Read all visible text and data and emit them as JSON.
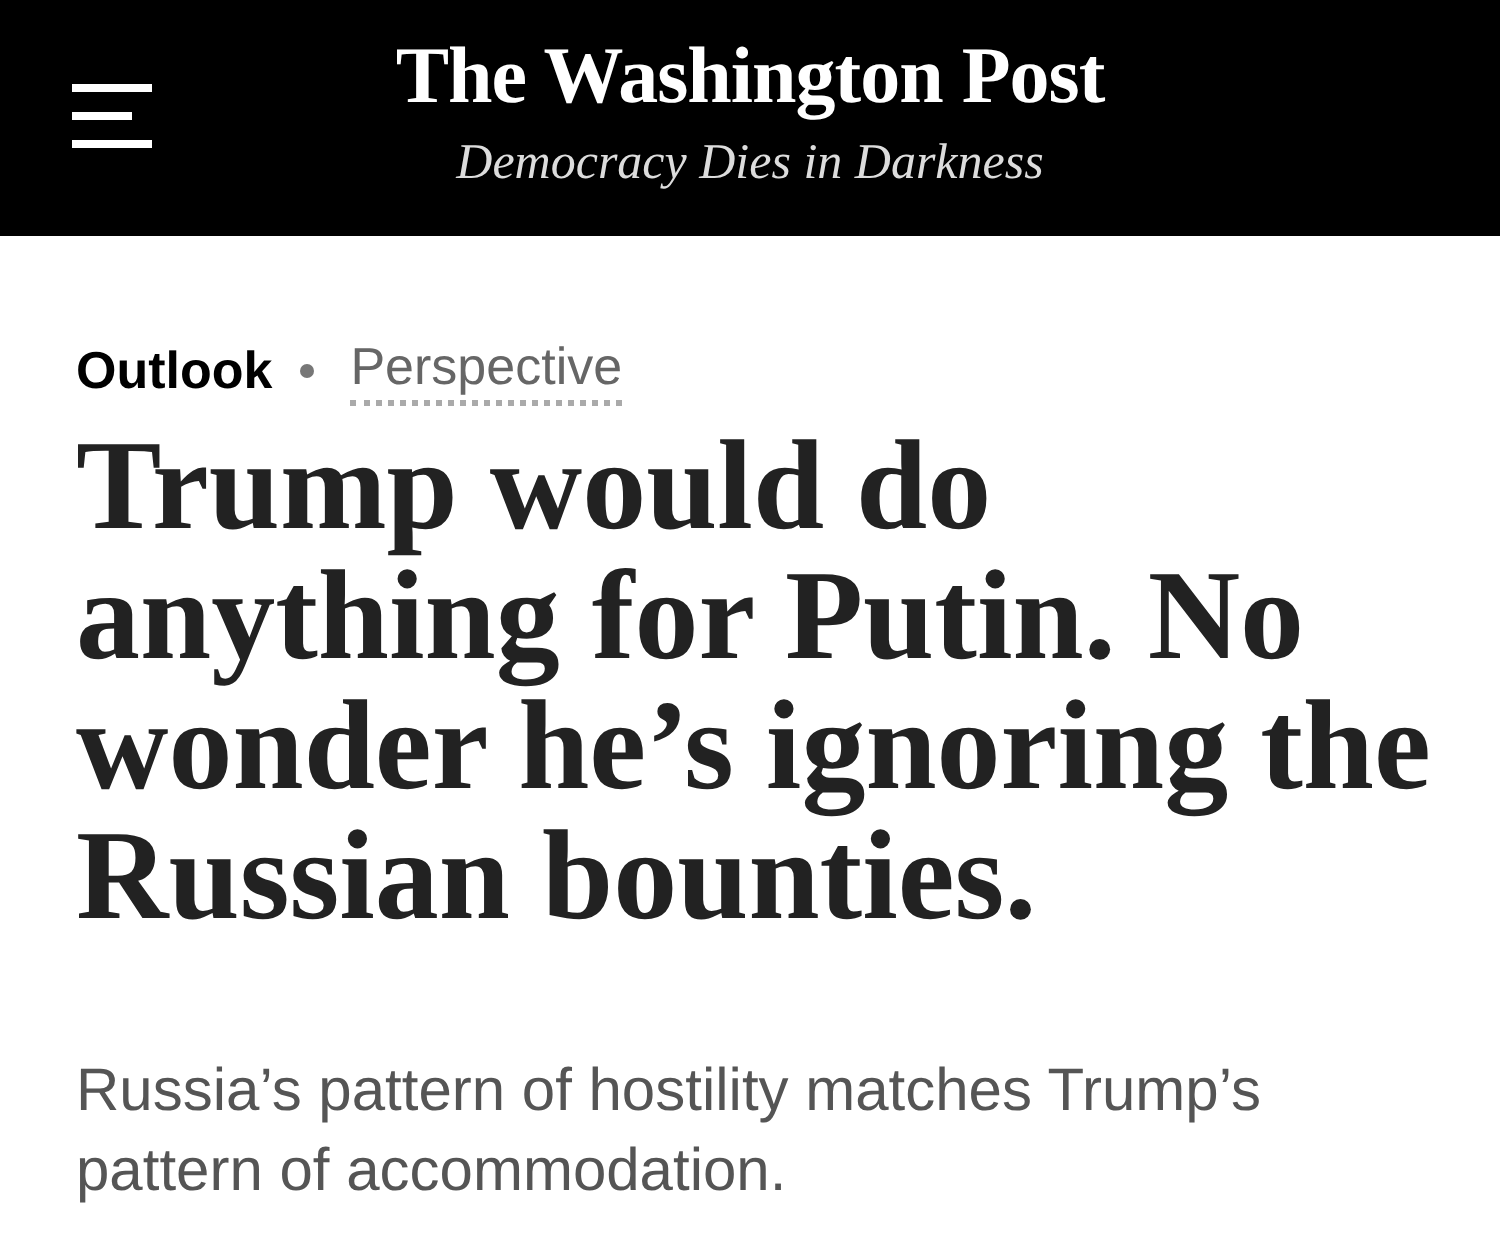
{
  "header": {
    "logo": "The Washington Post",
    "tagline": "Democracy Dies in Darkness"
  },
  "article": {
    "section": "Outlook",
    "label": "Perspective",
    "headline": "Trump would do anything for Putin. No wonder he’s ignoring the Russian bounties.",
    "subheadline": "Russia’s pattern of hostility matches Trump’s pattern of accommodation."
  }
}
